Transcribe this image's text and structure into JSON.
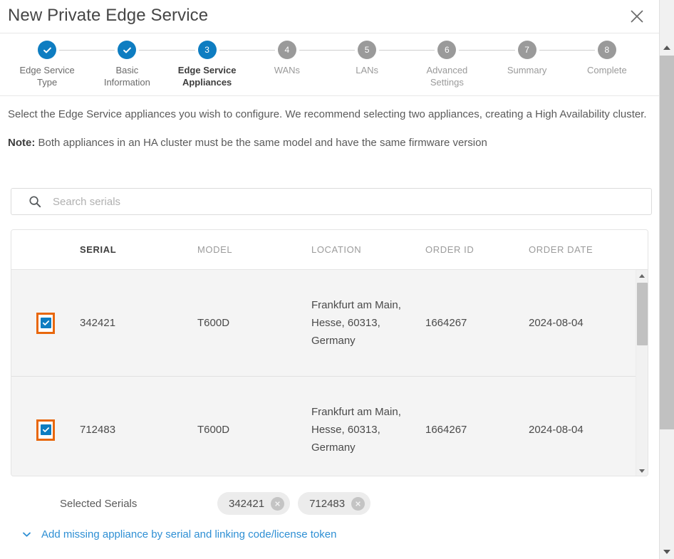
{
  "window": {
    "title": "New Private Edge Service",
    "close_icon": "close-icon"
  },
  "stepper": {
    "steps": [
      {
        "number": "1",
        "label": "Edge Service\nType",
        "state": "done"
      },
      {
        "number": "2",
        "label": "Basic\nInformation",
        "state": "done"
      },
      {
        "number": "3",
        "label": "Edge Service\nAppliances",
        "state": "active"
      },
      {
        "number": "4",
        "label": "WANs",
        "state": "todo"
      },
      {
        "number": "5",
        "label": "LANs",
        "state": "todo"
      },
      {
        "number": "6",
        "label": "Advanced\nSettings",
        "state": "todo"
      },
      {
        "number": "7",
        "label": "Summary",
        "state": "todo"
      },
      {
        "number": "8",
        "label": "Complete",
        "state": "todo"
      }
    ]
  },
  "description": {
    "paragraph": "Select the Edge Service appliances you wish to configure. We recommend selecting two appliances, creating a High Availability cluster.",
    "note_prefix": "Note:",
    "note_text": " Both appliances in an HA cluster must be the same model and have the same firmware version"
  },
  "search": {
    "placeholder": "Search serials",
    "value": "",
    "icon": "search-icon"
  },
  "table": {
    "columns": [
      {
        "key": "serial",
        "label": "SERIAL",
        "sorted": true
      },
      {
        "key": "model",
        "label": "MODEL",
        "sorted": false
      },
      {
        "key": "location",
        "label": "LOCATION",
        "sorted": false
      },
      {
        "key": "order_id",
        "label": "ORDER ID",
        "sorted": false
      },
      {
        "key": "order_date",
        "label": "ORDER DATE",
        "sorted": false
      }
    ],
    "rows": [
      {
        "checked": true,
        "serial": "342421",
        "model": "T600D",
        "location": "Frankfurt am Main, Hesse, 60313, Germany",
        "order_id": "1664267",
        "order_date": "2024-08-04"
      },
      {
        "checked": true,
        "serial": "712483",
        "model": "T600D",
        "location": "Frankfurt am Main, Hesse, 60313, Germany",
        "order_id": "1664267",
        "order_date": "2024-08-04"
      }
    ]
  },
  "selected_serials": {
    "label": "Selected Serials",
    "chips": [
      {
        "value": "342421",
        "remove_icon": "remove-icon"
      },
      {
        "value": "712483",
        "remove_icon": "remove-icon"
      }
    ]
  },
  "add_missing": {
    "chevron_icon": "chevron-down-icon",
    "label": "Add missing appliance by serial and linking code/license token"
  },
  "colors": {
    "accent_blue": "#0e7dc1",
    "link_blue": "#2e8fd4",
    "focus_orange": "#e8670c",
    "step_gray": "#9a9a9a",
    "row_bg": "#f4f4f4"
  }
}
